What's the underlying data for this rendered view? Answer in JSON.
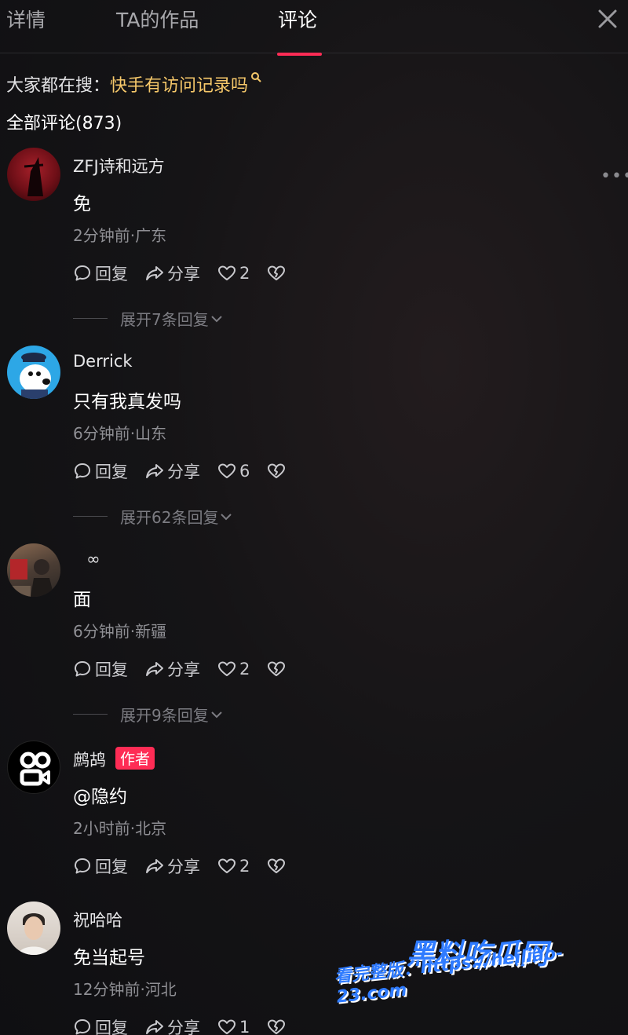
{
  "tabs": [
    {
      "label": "详情"
    },
    {
      "label": "TA的作品"
    },
    {
      "label": "评论"
    }
  ],
  "search_hint": {
    "prefix": "大家都在搜：",
    "query": "快手有访问记录吗"
  },
  "all_comments_label": "全部评论(873)",
  "comments": [
    {
      "username": "ZFJ诗和远方",
      "content": "免",
      "meta": "2分钟前·广东",
      "reply": "回复",
      "share": "分享",
      "likes": "2",
      "expand": "展开7条回复"
    },
    {
      "username": "Derrick",
      "content": "只有我真发吗",
      "meta": "6分钟前·山东",
      "reply": "回复",
      "share": "分享",
      "likes": "6",
      "expand": "展开62条回复"
    },
    {
      "username": "∞",
      "content": "面",
      "meta": "6分钟前·新疆",
      "reply": "回复",
      "share": "分享",
      "likes": "2",
      "expand": "展开9条回复"
    },
    {
      "username": "鹧鸪",
      "badge": "作者",
      "content": "@隐约",
      "meta": "2小时前·北京",
      "reply": "回复",
      "share": "分享",
      "likes": "2"
    },
    {
      "username": "祝哈哈",
      "content": "免当起号",
      "meta": "12分钟前·河北",
      "reply": "回复",
      "share": "分享",
      "likes": "1"
    }
  ],
  "watermark": {
    "title": "黑料吃瓜网",
    "line": "看完整版：https://heiliao-23.com"
  },
  "colors": {
    "accent": "#fe2c55",
    "highlight": "#f6c86a",
    "background": "#141416"
  }
}
